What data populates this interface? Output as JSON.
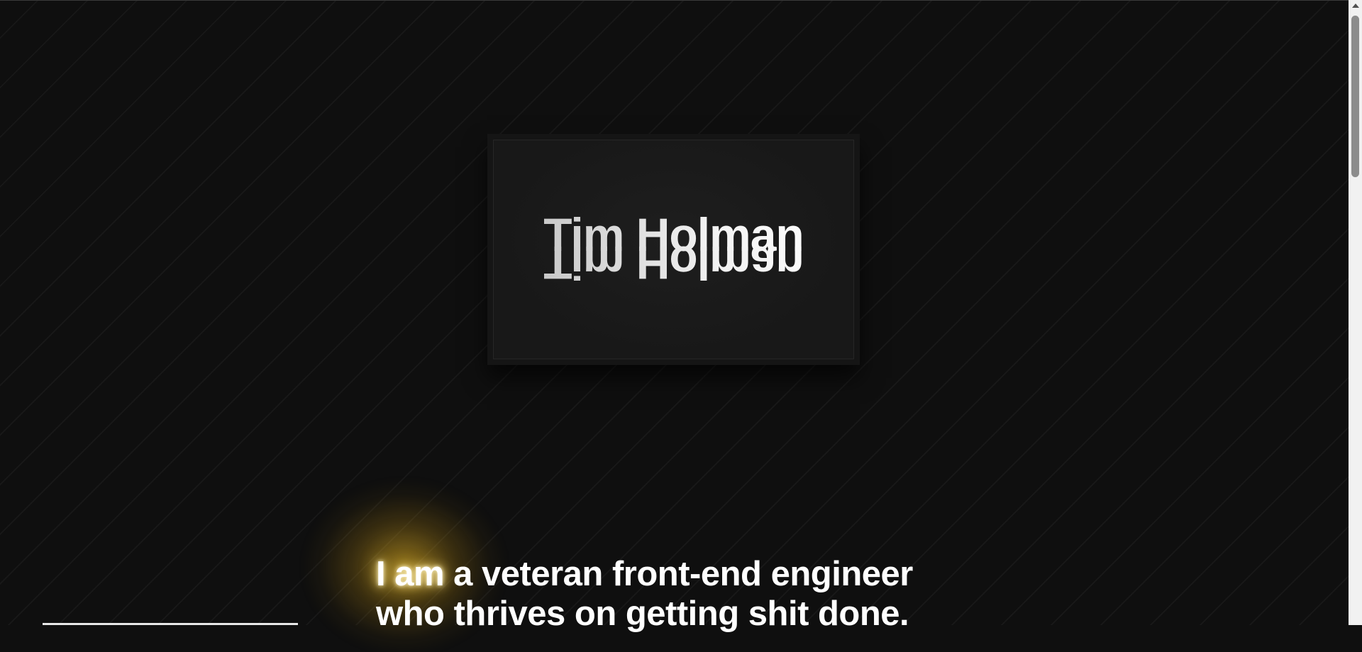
{
  "logo": {
    "name": "Tim Holman",
    "reflection": "Tim Holman"
  },
  "intro": {
    "highlight": "I am",
    "line1_rest": " a veteran front-end engineer",
    "line2": "who thrives on getting shit done."
  },
  "colors": {
    "background": "#0f0f0f",
    "glow": "#ffd24a",
    "text": "#ffffff"
  }
}
